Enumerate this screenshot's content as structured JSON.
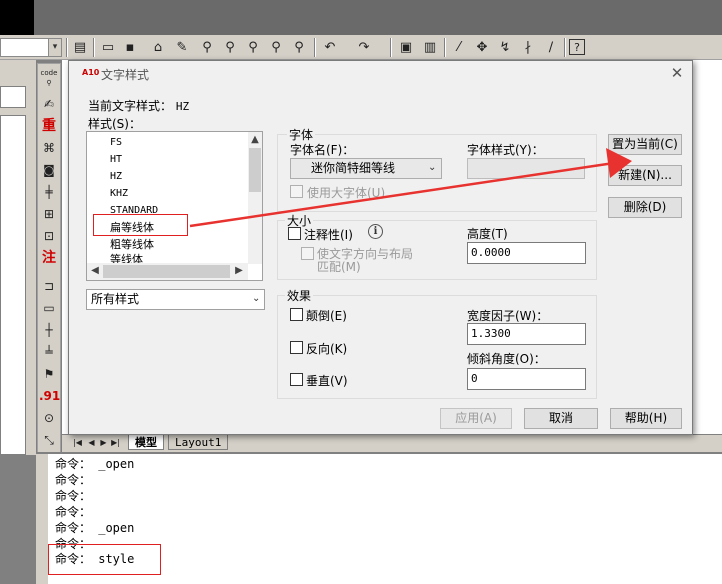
{
  "toolbar": {
    "icons": [
      "layer-icon",
      "open-icon",
      "save-icon",
      "eraser-icon",
      "brush-icon",
      "zoom-icon",
      "zoom-window-icon",
      "zoom-extents-icon",
      "zoom-prev-icon",
      "zoom-realtime-icon",
      "undo-icon",
      "redo-icon",
      "properties-icon",
      "design-center-icon",
      "match-icon",
      "pan-icon",
      "dist-icon",
      "snap-icon",
      "dim-icon",
      "help-icon"
    ]
  },
  "left_toolbar": {
    "code_label": "code",
    "red_char_1": "重",
    "red_char_2": "注",
    "num_label": ".91"
  },
  "dialog": {
    "title": "文字样式",
    "app_icon": "A10",
    "current_style_label": "当前文字样式：",
    "current_style_value": "HZ",
    "styles_label": "样式(S)：",
    "styles": [
      "FS",
      "HT",
      "HZ",
      "KHZ",
      "STANDARD",
      "扁等线体",
      "粗等线体",
      "等线体"
    ],
    "filter_value": "所有样式",
    "font_group_label": "字体",
    "font_name_label": "字体名(F)：",
    "font_name_value": "迷你简特细等线",
    "font_style_label": "字体样式(Y)：",
    "use_big_font_label": "使用大字体(U)",
    "size_group_label": "大小",
    "annotative_label": "注释性(I)",
    "match_orientation_label_1": "使文字方向与布局",
    "match_orientation_label_2": "匹配(M)",
    "height_label": "高度(T)",
    "height_value": "0.0000",
    "effects_group_label": "效果",
    "upside_down_label": "颠倒(E)",
    "backwards_label": "反向(K)",
    "vertical_label": "垂直(V)",
    "width_factor_label": "宽度因子(W)：",
    "width_factor_value": "1.3300",
    "oblique_label": "倾斜角度(O)：",
    "oblique_value": "0",
    "set_current_button": "置为当前(C)",
    "new_button": "新建(N)...",
    "delete_button": "删除(D)",
    "apply_button": "应用(A)",
    "cancel_button": "取消",
    "help_button": "帮助(H)"
  },
  "tabs": {
    "model": "模型",
    "layout1": "Layout1"
  },
  "command_lines": [
    "命令： _open",
    "命令：",
    "命令：",
    "命令：",
    "命令： _open",
    "命令：",
    "命令： style"
  ],
  "annotation": {
    "box_color": "#e02020",
    "arrow_color": "#e8322f"
  }
}
